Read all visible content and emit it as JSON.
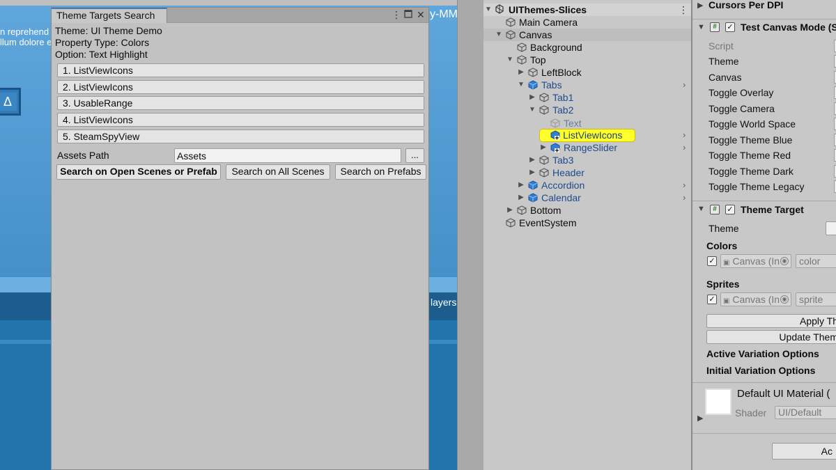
{
  "game_view": {
    "text_line1": "n reprehend",
    "text_line2": "llum dolore e",
    "title_fragment": "y-MM",
    "button_glyph": "Δ",
    "players_fragment": "layers"
  },
  "theme_search": {
    "window_title": "Theme Targets Search",
    "theme_line": "Theme: UI Theme Demo",
    "property_type_line": "Property Type: Colors",
    "option_line": "Option: Text Highlight",
    "results": [
      "1. ListViewIcons",
      "2. ListViewIcons",
      "3. UsableRange",
      "4. ListViewIcons",
      "5. SteamSpyView"
    ],
    "assets_path_label": "Assets Path",
    "assets_path_value": "Assets",
    "browse_label": "...",
    "btn_open_scenes": "Search on Open Scenes or Prefab",
    "btn_all_scenes": "Search on All Scenes",
    "btn_prefabs": "Search on Prefabs"
  },
  "hierarchy": {
    "scene_name": "UIThemes-Slices",
    "items": [
      {
        "label": "Main Camera"
      },
      {
        "label": "Canvas"
      },
      {
        "label": "Background"
      },
      {
        "label": "Top"
      },
      {
        "label": "LeftBlock"
      },
      {
        "label": "Tabs"
      },
      {
        "label": "Tab1"
      },
      {
        "label": "Tab2"
      },
      {
        "label": "Text"
      },
      {
        "label": "ListViewIcons"
      },
      {
        "label": "RangeSlider"
      },
      {
        "label": "Tab3"
      },
      {
        "label": "Header"
      },
      {
        "label": "Accordion"
      },
      {
        "label": "Calendar"
      },
      {
        "label": "Bottom"
      },
      {
        "label": "EventSystem"
      }
    ],
    "highlight_color": "#ffff2a",
    "prefab_color": "#1f4a8c"
  },
  "inspector": {
    "cursors_per_dpi": "Cursors Per DPI",
    "test_canvas_mode_title": "Test Canvas Mode (S",
    "test_canvas_props": [
      "Script",
      "Theme",
      "Canvas",
      "Toggle Overlay",
      "Toggle Camera",
      "Toggle World Space",
      "Toggle Theme Blue",
      "Toggle Theme Red",
      "Toggle Theme Dark",
      "Toggle Theme Legacy"
    ],
    "theme_target_title": "Theme Target",
    "theme_label": "Theme",
    "colors_label": "Colors",
    "colors_object": "Canvas (In",
    "colors_property": "color",
    "sprites_label": "Sprites",
    "sprites_object": "Canvas (In",
    "sprites_property": "sprite",
    "apply_button": "Apply Th",
    "update_button": "Update Them",
    "active_variation": "Active Variation Options",
    "initial_variation": "Initial Variation Options",
    "material_name": "Default UI Material (",
    "shader_label": "Shader",
    "shader_value": "UI/Default",
    "add_button": "Ac"
  }
}
